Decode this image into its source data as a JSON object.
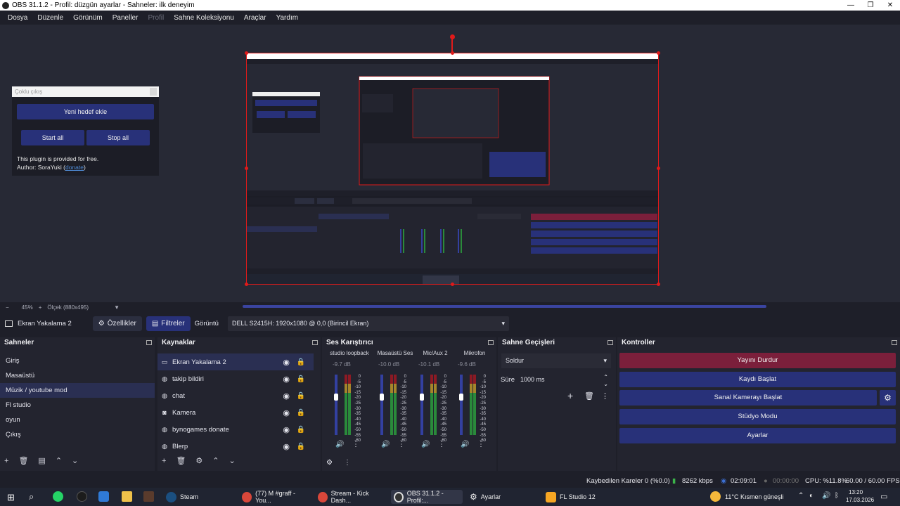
{
  "window": {
    "title": "OBS 31.1.2 - Profil: düzgün ayarlar - Sahneler: ilk deneyim",
    "minimize": "—",
    "maximize": "❐",
    "close": "✕"
  },
  "menu": [
    "Dosya",
    "Düzenle",
    "Görünüm",
    "Paneller",
    "Profil",
    "Sahne Koleksiyonu",
    "Araçlar",
    "Yardım"
  ],
  "multi_output": {
    "title": "Çoklu çıkış",
    "add_target": "Yeni hedef ekle",
    "start_all": "Start all",
    "stop_all": "Stop all",
    "note_line1": "This plugin is provided for free.",
    "note_line2_prefix": "Author: SoraYuki (",
    "note_link": "donate",
    "note_line2_suffix": ")"
  },
  "preview_bar": {
    "minus": "−",
    "zoom": "45%",
    "plus": "+",
    "scale": "Ölçek (880x495)"
  },
  "source_toolbar": {
    "source_name": "Ekran Yakalama 2",
    "properties": "Özellikler",
    "filters": "Filtreler",
    "display_label": "Görüntü",
    "display_value": "DELL S2415H: 1920x1080 @ 0,0 (Birincil Ekran)"
  },
  "scenes": {
    "title": "Sahneler",
    "items": [
      "Giriş",
      "Masaüstü",
      "Müzik / youtube mod",
      "Fl studio",
      "oyun",
      "Çıkış"
    ],
    "selected": 2
  },
  "sources": {
    "title": "Kaynaklar",
    "items": [
      "Ekran Yakalama 2",
      "takip bildiri",
      "chat",
      "Kamera",
      "bynogames donate",
      "Blerp"
    ],
    "icons": [
      "monitor-icon",
      "globe-icon",
      "globe-icon",
      "camera-icon",
      "globe-icon",
      "globe-icon"
    ]
  },
  "mixer": {
    "title": "Ses Karıştırıcı",
    "channels": [
      {
        "name": "studio loopback",
        "db": "-9.7 dB",
        "level": 0.65
      },
      {
        "name": "Masaüstü Ses",
        "db": "-10.0 dB",
        "level": 0.62
      },
      {
        "name": "Mic/Aux 2",
        "db": "-10.1 dB",
        "level": 0.61
      },
      {
        "name": "Mikrofon",
        "db": "-9.6 dB",
        "level": 0.66
      }
    ],
    "scale": [
      "0",
      "-5",
      "-10",
      "-15",
      "-20",
      "-25",
      "-30",
      "-35",
      "-40",
      "-45",
      "-50",
      "-55",
      "-60"
    ]
  },
  "transitions": {
    "title": "Sahne Geçişleri",
    "selected": "Soldur",
    "duration_label": "Süre",
    "duration_value": "1000 ms"
  },
  "controls": {
    "title": "Kontroller",
    "stop_stream": "Yayını Durdur",
    "start_record": "Kaydı Başlat",
    "start_vcam": "Sanal Kamerayı Başlat",
    "studio_mode": "Stüdyo Modu",
    "settings": "Ayarlar"
  },
  "status": {
    "dropped_frames": "Kaybedilen Kareler 0 (%0.0)",
    "bitrate": "8262 kbps",
    "stream_time": "02:09:01",
    "record_time": "00:00:00",
    "cpu": "CPU: %11.8%",
    "fps": "60.00 / 60.00 FPS"
  },
  "taskbar": {
    "apps": [
      "Steam",
      "(77) M #graff - You...",
      "Stream - Kick Dash...",
      "OBS 31.1.2 - Profil:...",
      "Ayarlar",
      "FL Studio 12"
    ],
    "weather": "11°C  Kısmen güneşli",
    "time": "13:20",
    "date": "17.03.2026"
  },
  "colors": {
    "accent": "#283179",
    "stop": "#7b1f3b",
    "selection": "#2a2f52",
    "bounding_box": "#e01a1a"
  }
}
